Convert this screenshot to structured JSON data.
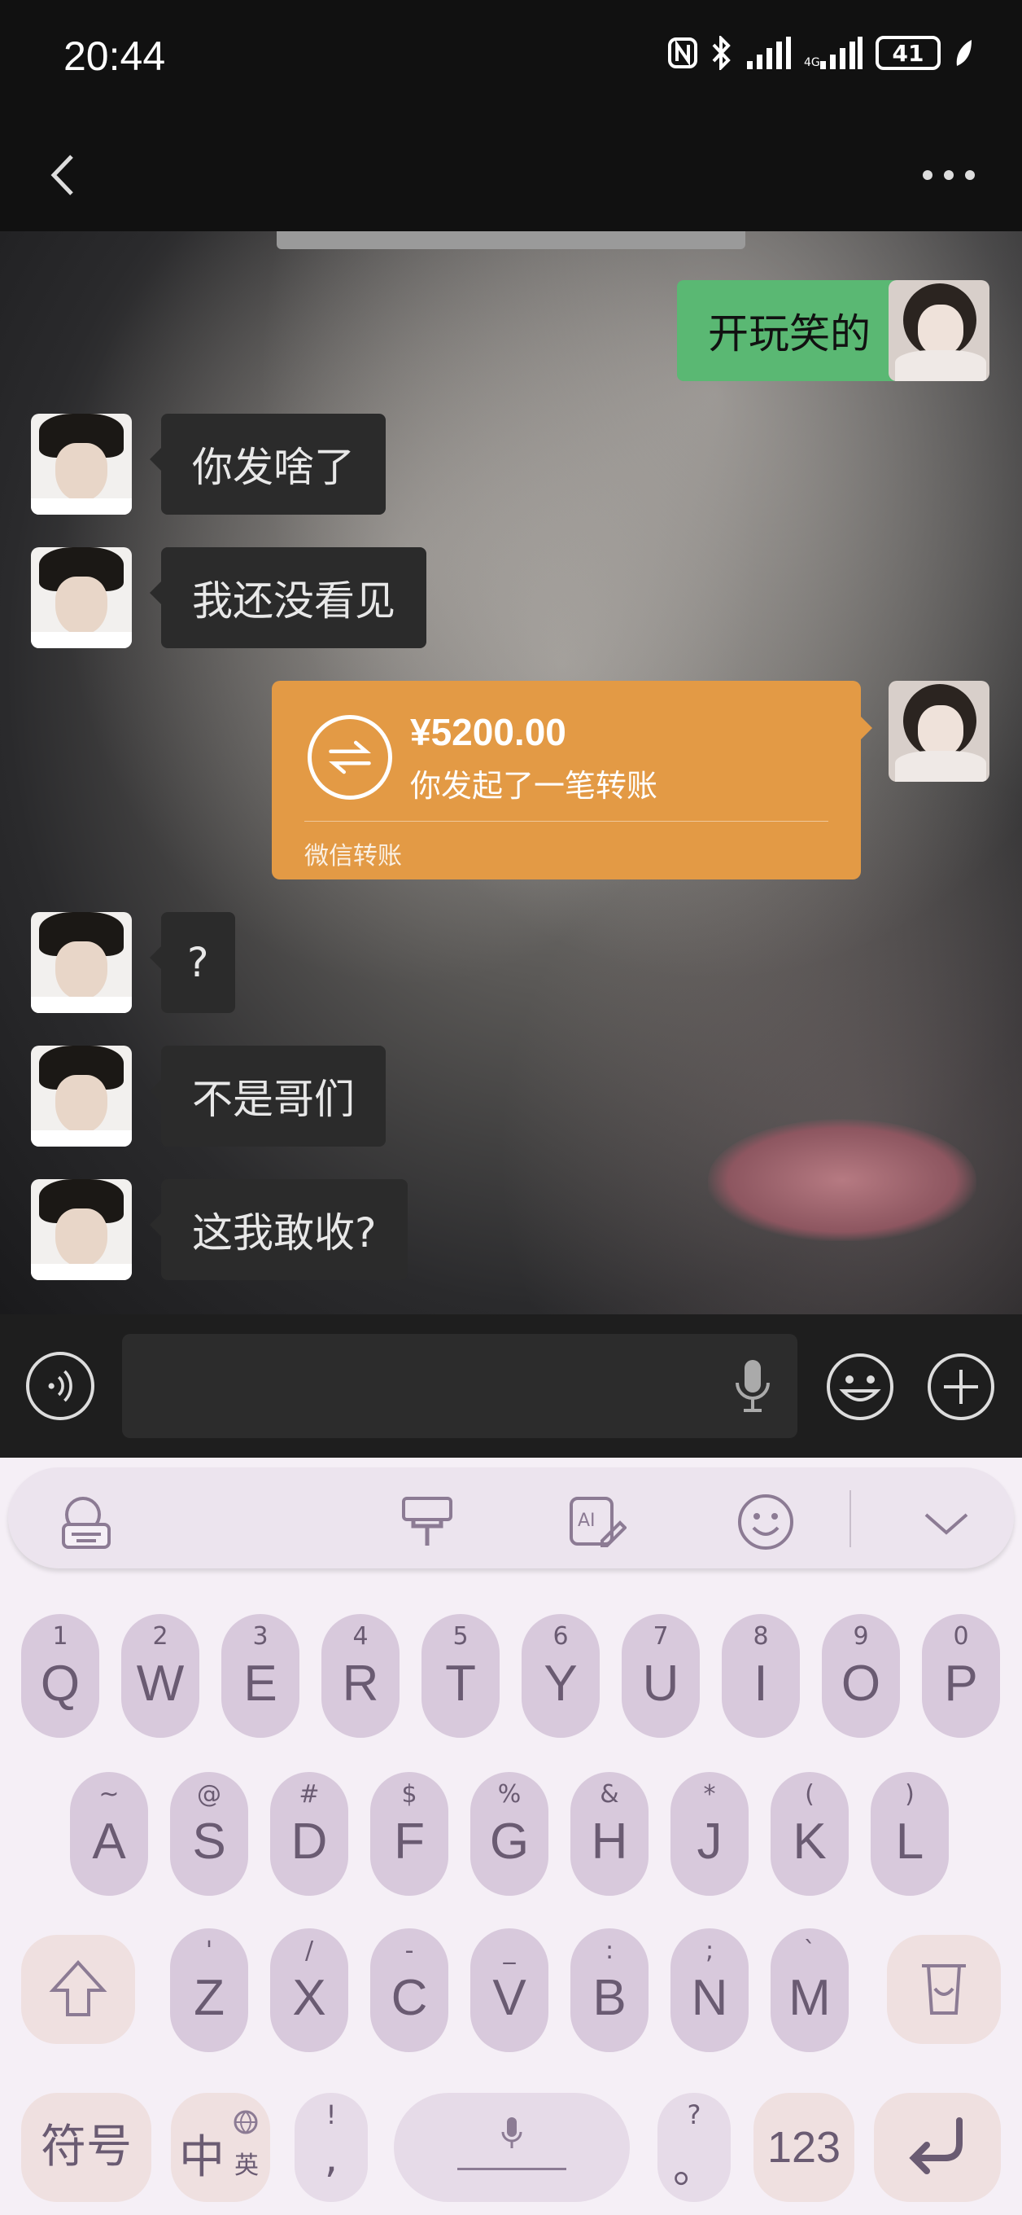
{
  "status_bar": {
    "time": "20:44",
    "battery": "41",
    "icons": [
      "nfc-icon",
      "bluetooth-icon",
      "signal-icon",
      "signal-icon",
      "battery-icon",
      "leaf-icon"
    ]
  },
  "header": {
    "title": "",
    "back_icon": "chevron-left-icon",
    "more_icon": "more-dots-icon"
  },
  "messages": [
    {
      "from": "me",
      "text": "开玩笑的"
    },
    {
      "from": "them",
      "text": "你发啥了"
    },
    {
      "from": "them",
      "text": "我还没看见"
    },
    {
      "from": "me",
      "type": "transfer",
      "amount": "¥5200.00",
      "desc": "你发起了一笔转账",
      "source": "微信转账"
    },
    {
      "from": "them",
      "text": "?"
    },
    {
      "from": "them",
      "text": "不是哥们"
    },
    {
      "from": "them",
      "text": "这我敢收?"
    }
  ],
  "input_bar": {
    "value": "",
    "icons": [
      "voice-icon",
      "mic-icon",
      "emoji-icon",
      "plus-icon"
    ]
  },
  "keyboard": {
    "toolbar_icons": [
      "keyboard-globe-icon",
      "theme-brush-icon",
      "ai-write-icon",
      "emoji-face-icon",
      "chevron-down-icon"
    ],
    "row1": [
      {
        "main": "Q",
        "sub": "1"
      },
      {
        "main": "W",
        "sub": "2"
      },
      {
        "main": "E",
        "sub": "3"
      },
      {
        "main": "R",
        "sub": "4"
      },
      {
        "main": "T",
        "sub": "5"
      },
      {
        "main": "Y",
        "sub": "6"
      },
      {
        "main": "U",
        "sub": "7"
      },
      {
        "main": "I",
        "sub": "8"
      },
      {
        "main": "O",
        "sub": "9"
      },
      {
        "main": "P",
        "sub": "0"
      }
    ],
    "row2": [
      {
        "main": "A",
        "sub": "~"
      },
      {
        "main": "S",
        "sub": "@"
      },
      {
        "main": "D",
        "sub": "#"
      },
      {
        "main": "F",
        "sub": "$"
      },
      {
        "main": "G",
        "sub": "%"
      },
      {
        "main": "H",
        "sub": "&"
      },
      {
        "main": "J",
        "sub": "*"
      },
      {
        "main": "K",
        "sub": "("
      },
      {
        "main": "L",
        "sub": ")"
      }
    ],
    "row3": [
      {
        "main": "Z",
        "sub": "'"
      },
      {
        "main": "X",
        "sub": "/"
      },
      {
        "main": "C",
        "sub": "-"
      },
      {
        "main": "V",
        "sub": "_"
      },
      {
        "main": "B",
        "sub": ":"
      },
      {
        "main": "N",
        "sub": ";"
      },
      {
        "main": "M",
        "sub": "`"
      }
    ],
    "symbols_label": "符号",
    "lang_label": "中",
    "lang_sub": "英",
    "comma_main": ",",
    "comma_sub": "!",
    "period_main": "。",
    "period_sub": "?",
    "num_label": "123"
  }
}
